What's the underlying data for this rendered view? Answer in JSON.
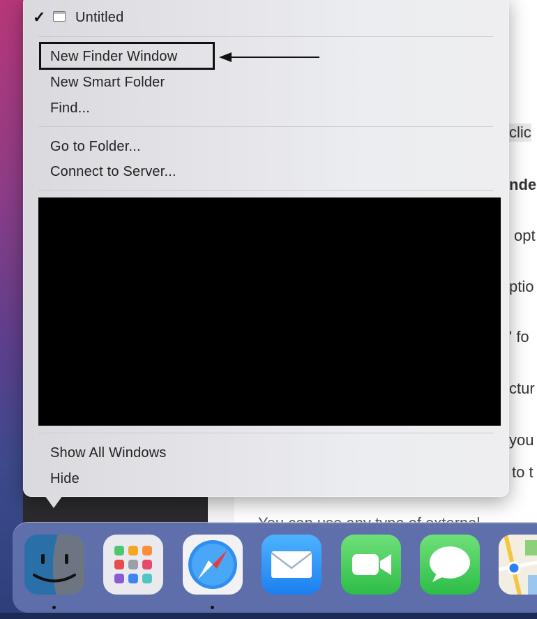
{
  "menu": {
    "window_title": "Untitled",
    "items": [
      {
        "label": "New Finder Window",
        "highlighted": true
      },
      {
        "label": "New Smart Folder"
      },
      {
        "label": "Find..."
      },
      {
        "label": "Go to Folder..."
      },
      {
        "label": "Connect to Server..."
      },
      {
        "label": "Show All Windows"
      },
      {
        "label": "Hide"
      }
    ]
  },
  "background_doc": {
    "fragments": [
      "clic",
      "nder",
      "opt",
      "ptio",
      "' fo",
      "ctur",
      "you",
      "to t",
      "You can use any type of external"
    ]
  },
  "dock": {
    "apps": [
      {
        "name": "Finder",
        "icon": "finder-icon",
        "running": true
      },
      {
        "name": "Launchpad",
        "icon": "launchpad-icon",
        "running": false
      },
      {
        "name": "Safari",
        "icon": "safari-icon",
        "running": true
      },
      {
        "name": "Mail",
        "icon": "mail-icon",
        "running": false
      },
      {
        "name": "FaceTime",
        "icon": "facetime-icon",
        "running": false
      },
      {
        "name": "Messages",
        "icon": "messages-icon",
        "running": false
      },
      {
        "name": "Maps",
        "icon": "maps-icon",
        "running": false
      }
    ]
  },
  "colors": {
    "annotation": "#111111",
    "redaction": "#000000"
  }
}
